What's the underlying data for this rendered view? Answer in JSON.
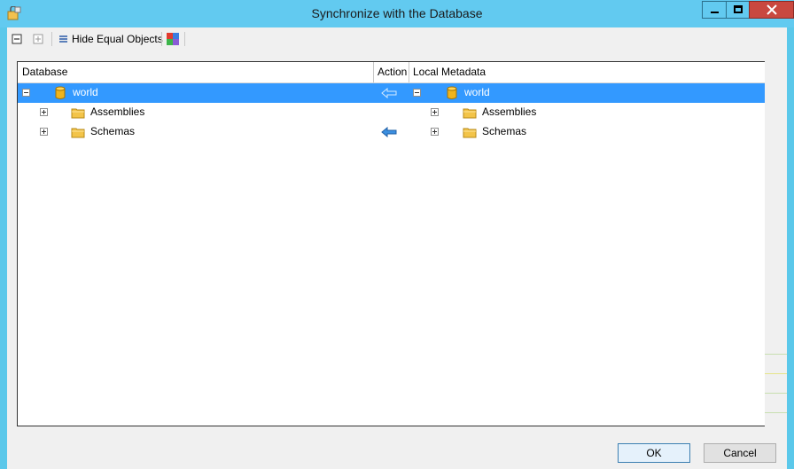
{
  "window": {
    "title": "Synchronize with the Database",
    "controls": [
      "minimize",
      "maximize",
      "close"
    ]
  },
  "toolbar": {
    "collapse_all_icon": "minus-box-icon",
    "expand_all_icon": "plus-box-icon",
    "hide_equal_label": "Hide Equal Objects",
    "color_icon": "color-palette-icon"
  },
  "grid": {
    "columns": {
      "database": "Database",
      "action": "Action",
      "local": "Local Metadata"
    },
    "rows": [
      {
        "db_name": "world",
        "db_icon": "database-icon",
        "local_name": "world",
        "local_icon": "database-icon",
        "action_icon": "arrow-left-outline-icon",
        "expanded": true,
        "selected": true
      },
      {
        "db_name": "Assemblies",
        "db_icon": "folder-icon",
        "local_name": "Assemblies",
        "local_icon": "folder-icon",
        "action_icon": "",
        "expanded": false,
        "selected": false
      },
      {
        "db_name": "Schemas",
        "db_icon": "folder-icon",
        "local_name": "Schemas",
        "local_icon": "folder-icon",
        "action_icon": "arrow-left-filled-icon",
        "expanded": false,
        "selected": false
      }
    ]
  },
  "buttons": {
    "ok": "OK",
    "cancel": "Cancel"
  },
  "colors": {
    "titlebar": "#62caf0",
    "selection": "#3399ff",
    "close": "#c9483f"
  }
}
